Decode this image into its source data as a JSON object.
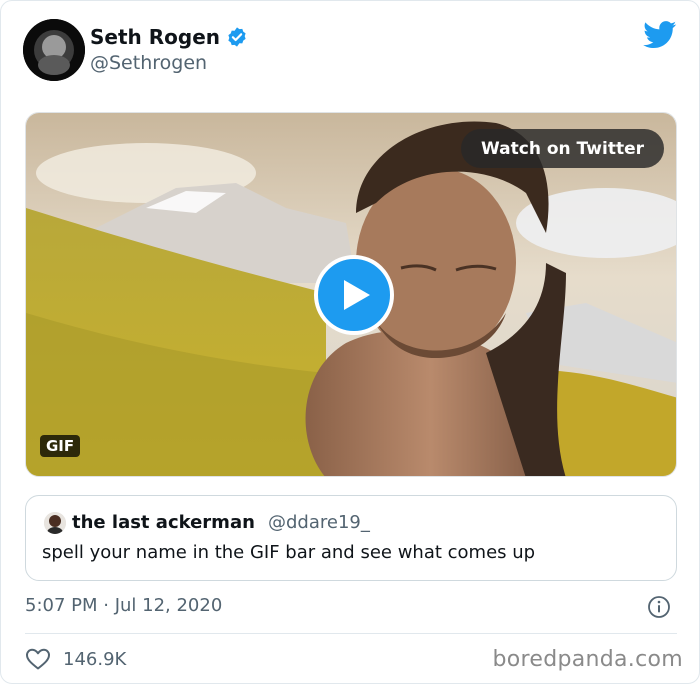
{
  "author": {
    "name": "Seth Rogen",
    "handle": "@Sethrogen",
    "verified": true
  },
  "media": {
    "watch_label": "Watch on Twitter",
    "badge": "GIF"
  },
  "quoted_tweet": {
    "name": "the last ackerman",
    "handle": "@ddare19_",
    "text": "spell your name in the GIF bar and see what comes up"
  },
  "meta": {
    "timestamp": "5:07 PM · Jul 12, 2020",
    "like_count": "146.9K"
  },
  "watermark": "boredpanda.com",
  "colors": {
    "accent": "#1d9bf0",
    "muted_text": "#536471"
  },
  "icons": [
    "verified-badge-icon",
    "twitter-bird-icon",
    "play-icon",
    "info-icon",
    "heart-icon"
  ]
}
